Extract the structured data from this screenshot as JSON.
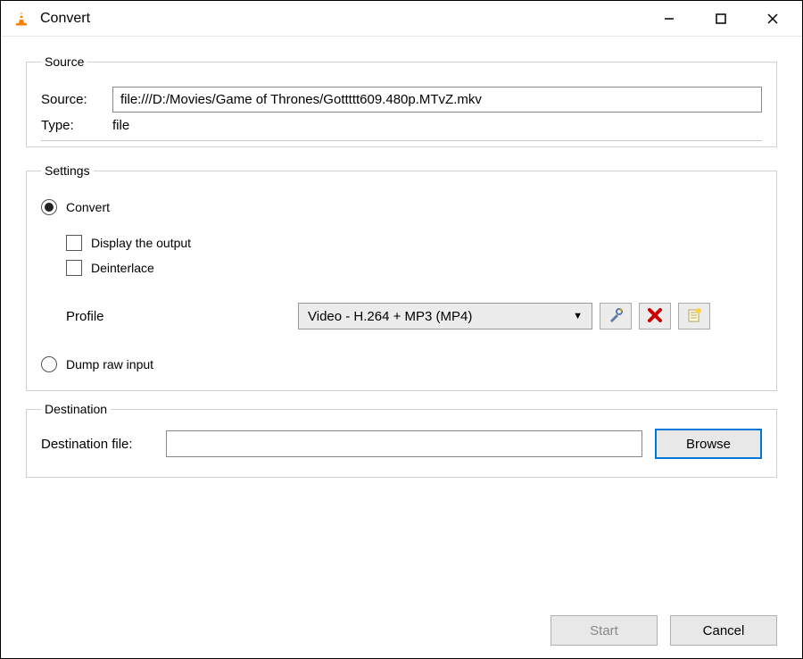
{
  "window": {
    "title": "Convert"
  },
  "source_group": {
    "legend": "Source",
    "source_label": "Source:",
    "source_value": "file:///D:/Movies/Game of Thrones/Gottttt609.480p.MTvZ.mkv",
    "type_label": "Type:",
    "type_value": "file"
  },
  "settings_group": {
    "legend": "Settings",
    "convert_label": "Convert",
    "display_output_label": "Display the output",
    "deinterlace_label": "Deinterlace",
    "profile_label": "Profile",
    "profile_value": "Video - H.264 + MP3 (MP4)",
    "dump_raw_label": "Dump raw input"
  },
  "destination_group": {
    "legend": "Destination",
    "dest_label": "Destination file:",
    "dest_value": "",
    "browse_label": "Browse"
  },
  "footer": {
    "start_label": "Start",
    "cancel_label": "Cancel"
  }
}
